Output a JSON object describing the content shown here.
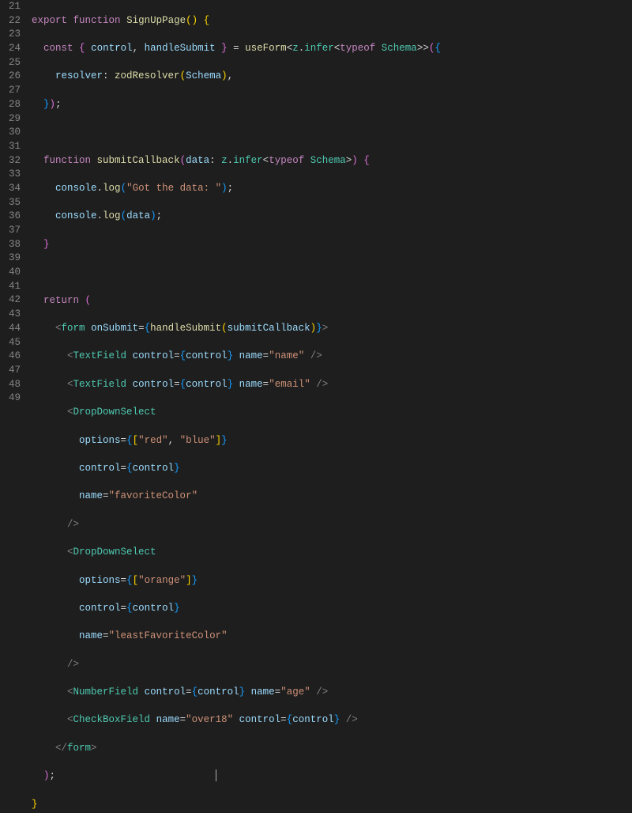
{
  "gutter": {
    "start": 21,
    "end": 49
  },
  "code": {
    "l21": {
      "kw_export": "export",
      "kw_function": "function",
      "fn": "SignUpPage"
    },
    "l22": {
      "kw_const": "const",
      "v_control": "control",
      "v_handleSubmit": "handleSubmit",
      "fn_useForm": "useForm",
      "t_z": "z",
      "t_infer": "infer",
      "kw_typeof": "typeof",
      "t_Schema": "Schema"
    },
    "l23": {
      "v_resolver": "resolver",
      "fn_zodResolver": "zodResolver",
      "v_Schema": "Schema"
    },
    "l26": {
      "kw_function": "function",
      "fn": "submitCallback",
      "v_data": "data",
      "t_z": "z",
      "t_infer": "infer",
      "kw_typeof": "typeof",
      "t_Schema": "Schema"
    },
    "l27": {
      "v_console": "console",
      "fn_log": "log",
      "str": "\"Got the data: \""
    },
    "l28": {
      "v_console": "console",
      "fn_log": "log",
      "v_data": "data"
    },
    "l31": {
      "kw_return": "return"
    },
    "l32": {
      "tag": "form",
      "attr_onSubmit": "onSubmit",
      "fn_handleSubmit": "handleSubmit",
      "v_submitCallback": "submitCallback"
    },
    "l33": {
      "tag": "TextField",
      "attr_control": "control",
      "v_control": "control",
      "attr_name": "name",
      "str": "\"name\""
    },
    "l34": {
      "tag": "TextField",
      "attr_control": "control",
      "v_control": "control",
      "attr_name": "name",
      "str": "\"email\""
    },
    "l35": {
      "tag": "DropDownSelect"
    },
    "l36": {
      "attr": "options",
      "s1": "\"red\"",
      "s2": "\"blue\""
    },
    "l37": {
      "attr": "control",
      "v": "control"
    },
    "l38": {
      "attr": "name",
      "str": "\"favoriteColor\""
    },
    "l40": {
      "tag": "DropDownSelect"
    },
    "l41": {
      "attr": "options",
      "s1": "\"orange\""
    },
    "l42": {
      "attr": "control",
      "v": "control"
    },
    "l43": {
      "attr": "name",
      "str": "\"leastFavoriteColor\""
    },
    "l45": {
      "tag": "NumberField",
      "attr_control": "control",
      "v_control": "control",
      "attr_name": "name",
      "str": "\"age\""
    },
    "l46": {
      "tag": "CheckBoxField",
      "attr_name": "name",
      "str": "\"over18\"",
      "attr_control": "control",
      "v_control": "control"
    },
    "l47": {
      "tag": "form"
    }
  }
}
